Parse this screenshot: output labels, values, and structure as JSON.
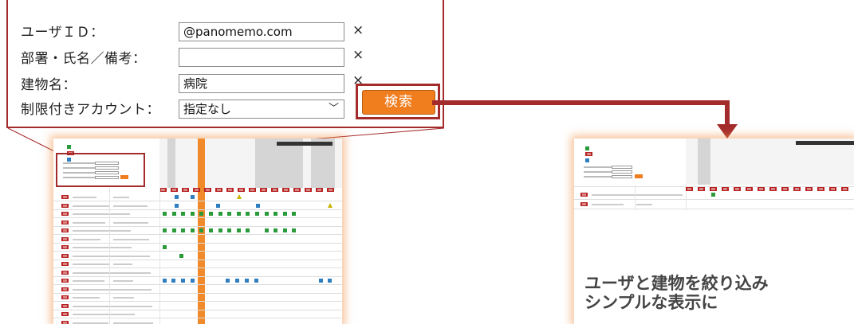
{
  "search_form": {
    "user_id_label": "ユーザＩＤ：",
    "user_id_value": "@panomemo.com",
    "dept_label": "部署・氏名／備考：",
    "dept_value": "",
    "building_label": "建物名：",
    "building_value": "病院",
    "restricted_label": "制限付きアカウント：",
    "restricted_value": "指定なし",
    "clear_symbol": "×",
    "search_button": "検索"
  },
  "caption": {
    "line1": "ユーザと建物を絞り込み",
    "line2": "シンプルな表示に"
  },
  "colors": {
    "accent_red": "#a32b2b",
    "button_orange": "#f07d1e",
    "glow_orange": "#f0965a"
  },
  "icons": [
    "clear-icon",
    "chevron-down-icon",
    "down-arrow-icon"
  ]
}
